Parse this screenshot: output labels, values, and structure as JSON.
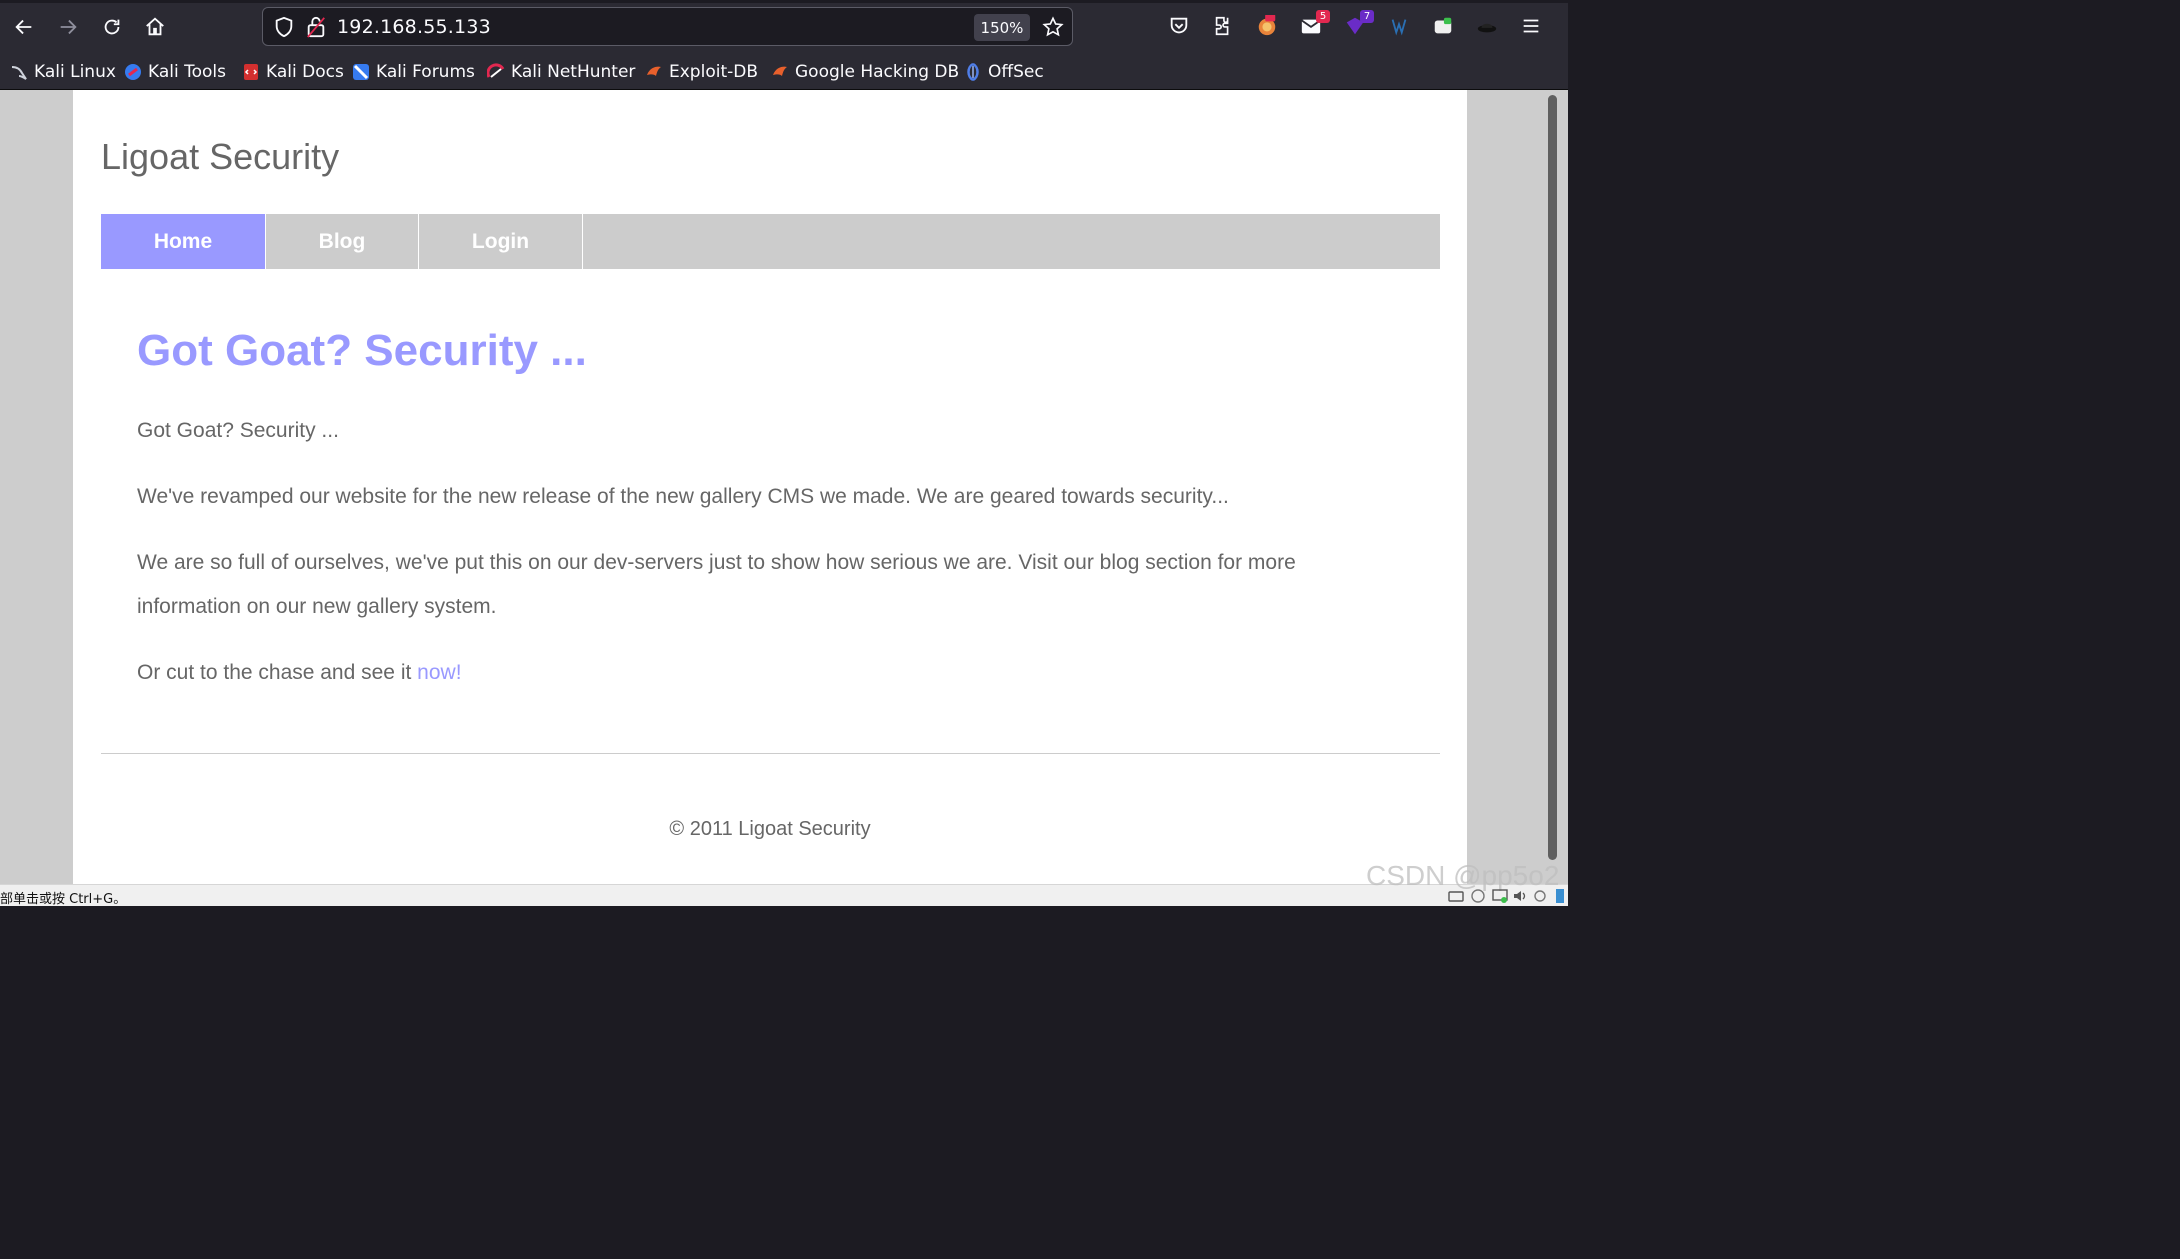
{
  "browser": {
    "url": "192.168.55.133",
    "zoom": "150%",
    "badges": {
      "mail": "5",
      "purple": "7"
    },
    "bookmarks": [
      {
        "label": "Kali Linux",
        "icon": "kali-dragon-icon"
      },
      {
        "label": "Kali Tools",
        "icon": "kali-tools-icon"
      },
      {
        "label": "Kali Docs",
        "icon": "kali-docs-icon"
      },
      {
        "label": "Kali Forums",
        "icon": "kali-forums-icon"
      },
      {
        "label": "Kali NetHunter",
        "icon": "kali-nethunter-icon"
      },
      {
        "label": "Exploit-DB",
        "icon": "exploit-db-icon"
      },
      {
        "label": "Google Hacking DB",
        "icon": "ghdb-icon"
      },
      {
        "label": "OffSec",
        "icon": "offsec-icon"
      }
    ]
  },
  "site": {
    "title": "Ligoat Security",
    "menu": [
      {
        "label": "Home",
        "active": true
      },
      {
        "label": "Blog",
        "active": false
      },
      {
        "label": "Login",
        "active": false
      }
    ],
    "headline": "Got Goat? Security ...",
    "paragraphs": [
      "Got Goat? Security ...",
      "We've revamped our website for the new release of the new gallery CMS we made. We are geared towards security...",
      "We are so full of ourselves, we've put this on our dev-servers just to show how serious we are. Visit our blog section for more information on our new gallery system."
    ],
    "cta_text": "Or cut to the chase and see it ",
    "cta_link": "now!",
    "footer": "© 2011 Ligoat Security"
  },
  "status": {
    "text": "部单击或按 Ctrl+G。",
    "watermark": "CSDN @pp5o2"
  },
  "colors": {
    "accent": "#9999ff",
    "text": "#666666",
    "menu_bg": "#cccccc",
    "chrome_bg": "#2b2a33"
  }
}
